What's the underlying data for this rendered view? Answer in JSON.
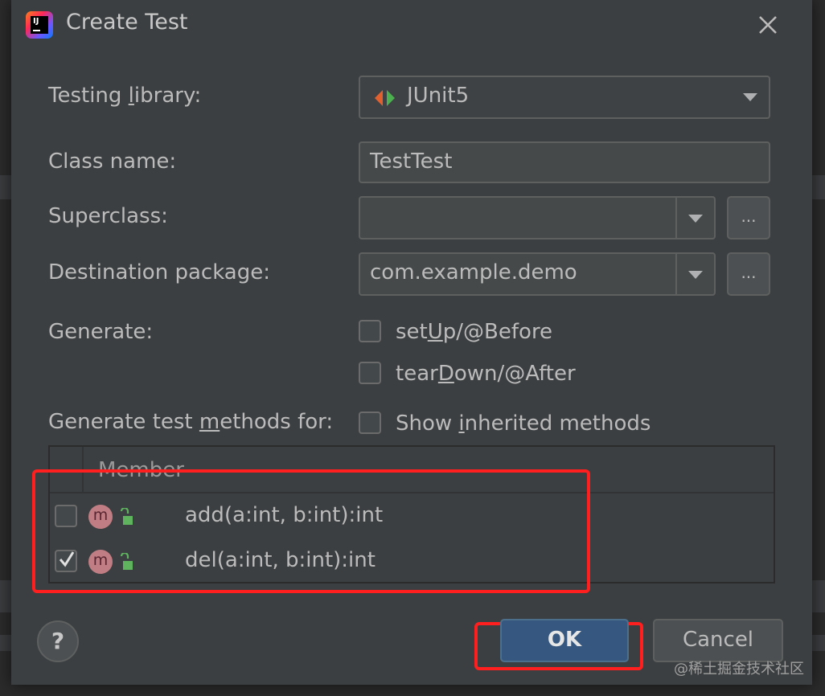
{
  "dialog": {
    "title": "Create Test",
    "close_icon": "close-icon",
    "app_icon": "intellij-idea-logo"
  },
  "form": {
    "testing_library": {
      "label_pre": "Testing ",
      "label_mnemonic": "l",
      "label_post": "ibrary:",
      "value": "JUnit5",
      "icon": "junit5-icon"
    },
    "class_name": {
      "label": "Class name:",
      "value": "TestTest"
    },
    "superclass": {
      "label": "Superclass:",
      "value": "",
      "browse_label": "..."
    },
    "destination_package": {
      "label": "Destination package:",
      "value": "com.example.demo",
      "browse_label": "..."
    },
    "generate": {
      "label": "Generate:",
      "setup": {
        "pre": "set",
        "mnemonic": "U",
        "post": "p/@Before",
        "checked": false
      },
      "teardown": {
        "pre": "tear",
        "mnemonic": "D",
        "post": "own/@After",
        "checked": false
      }
    },
    "methods_for": {
      "label_pre": "Generate test ",
      "label_mnemonic": "m",
      "label_post": "ethods for:",
      "show_inherited": {
        "pre": "Show ",
        "mnemonic": "i",
        "post": "nherited methods",
        "checked": false
      }
    }
  },
  "members_table": {
    "header": "Member",
    "rows": [
      {
        "signature": "add(a:int, b:int):int",
        "checked": false,
        "icon": "method-icon",
        "method_letter": "m",
        "visibility_icon": "public-lock-icon"
      },
      {
        "signature": "del(a:int, b:int):int",
        "checked": true,
        "icon": "method-icon",
        "method_letter": "m",
        "visibility_icon": "public-lock-icon"
      }
    ]
  },
  "buttons": {
    "help": "?",
    "ok": "OK",
    "cancel": "Cancel"
  },
  "watermark": "@稀土掘金技术社区",
  "colors": {
    "dialog_bg": "#3c3f41",
    "field_bg": "#45494a",
    "ok_button": "#365880",
    "highlight": "#ff1f1f",
    "method_icon": "#c07e84",
    "lock_icon": "#5fb35f"
  }
}
